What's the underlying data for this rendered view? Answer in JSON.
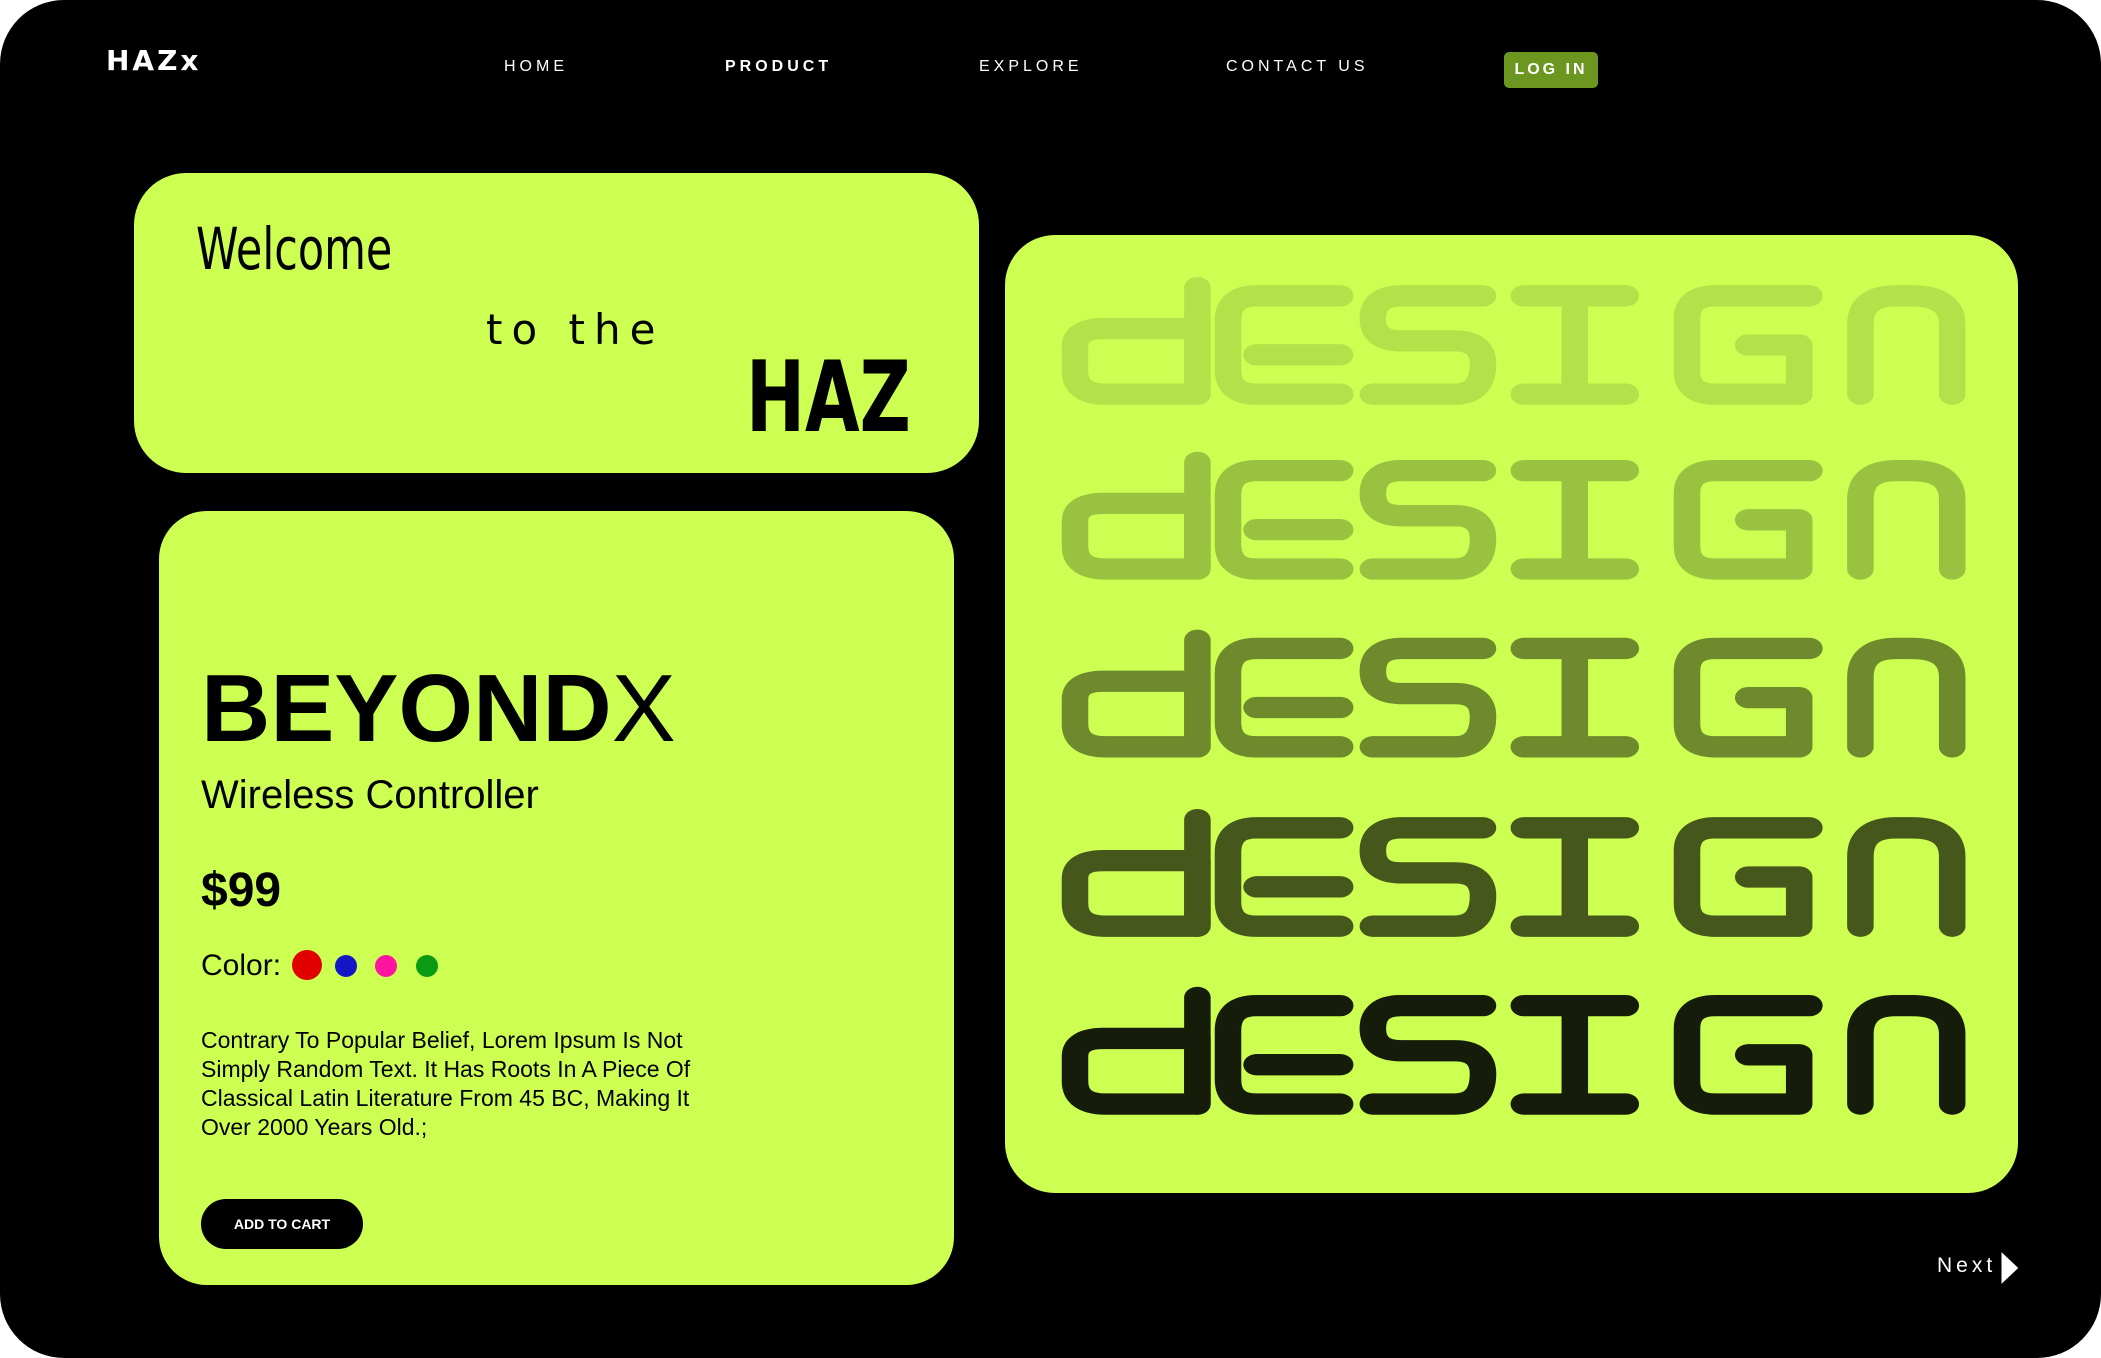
{
  "header": {
    "logo": "HAZx",
    "nav": [
      {
        "label": "HOME",
        "active": false
      },
      {
        "label": "PRODUCT",
        "active": true
      },
      {
        "label": "EXPLORE",
        "active": false
      },
      {
        "label": "CONTACT US",
        "active": false
      }
    ],
    "login_label": "LOG IN"
  },
  "hero": {
    "line1": "Welcome",
    "line2": "to the",
    "line3": "HAZ"
  },
  "product": {
    "brand_bold": "BEYOND",
    "brand_light": "X",
    "subtitle": "Wireless Controller",
    "price": "$99",
    "color_label": "Color:",
    "colors": [
      "#e00000",
      "#1515c8",
      "#ff14a0",
      "#0a9a14"
    ],
    "description": "Contrary To Popular Belief, Lorem Ipsum Is Not Simply Random Text. It Has Roots In A Piece Of Classical Latin Literature From 45 BC, Making It Over 2000 Years Old.;",
    "cart_label": "ADD TO CART"
  },
  "showcase": {
    "word": "design",
    "row_colors": [
      "#b2e24a",
      "#98c23f",
      "#6e8a2c",
      "#45571b",
      "#161c0a"
    ]
  },
  "footer": {
    "next_label": "Next"
  },
  "colors": {
    "accent": "#ccff52",
    "login_bg": "#6b9620",
    "background": "#000000"
  }
}
